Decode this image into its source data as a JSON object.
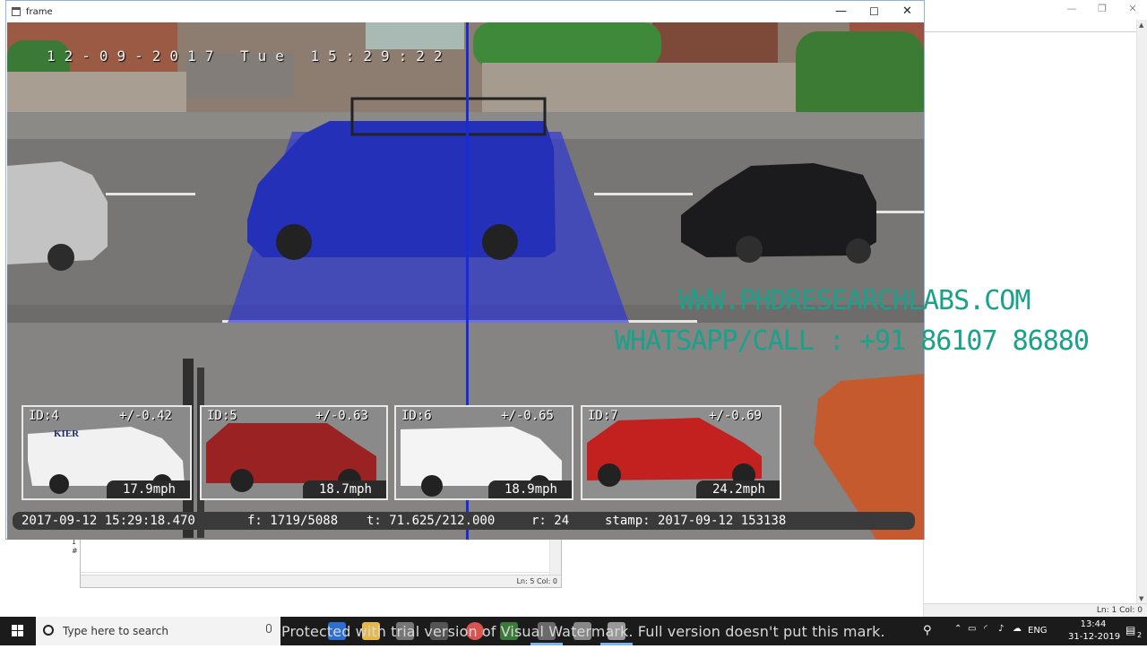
{
  "window": {
    "title": "frame",
    "minimize_glyph": "—",
    "maximize_glyph": "☐",
    "close_glyph": "✕",
    "icon": "app-window-icon"
  },
  "video": {
    "overlay_timestamp": "12-09-2017 Tue 15:29:22",
    "thumbnails": [
      {
        "id_label": "ID:4",
        "pm_label": "+/-0.42",
        "speed": "17.9mph",
        "logo_text": "KIER"
      },
      {
        "id_label": "ID:5",
        "pm_label": "+/-0.63",
        "speed": "18.7mph"
      },
      {
        "id_label": "ID:6",
        "pm_label": "+/-0.65",
        "speed": "18.9mph"
      },
      {
        "id_label": "ID:7",
        "pm_label": "+/-0.69",
        "speed": "24.2mph"
      }
    ],
    "info_bar": {
      "datetime": "2017-09-12 15:29:18.470",
      "frame": "f: 1719/5088",
      "time": "t: 71.625/212.000",
      "rate": "r: 24",
      "stamp": "stamp: 2017-09-12 153138"
    }
  },
  "watermark": {
    "line1": "WWW.PHDRESEARCHLABS.COM",
    "line2": "WHATSAPP/CALL : +91 86107 86880"
  },
  "small_editor": {
    "status": "Ln: 5   Col: 0",
    "side_chars": [
      "1",
      "#"
    ]
  },
  "background_window": {
    "status": "Ln: 1   Col: 0"
  },
  "taskbar": {
    "search_placeholder": "Type here to search",
    "visual_watermark_notice": "Protected with trial version of Visual Watermark. Full version doesn't put this mark.",
    "language": "ENG",
    "time": "13:44",
    "date": "31-12-2019",
    "notification_count": "2"
  },
  "colors": {
    "overlay_blue": "#1f2fd6",
    "watermark_teal": "#19a189",
    "taskbar_bg": "#1b1b1b"
  }
}
